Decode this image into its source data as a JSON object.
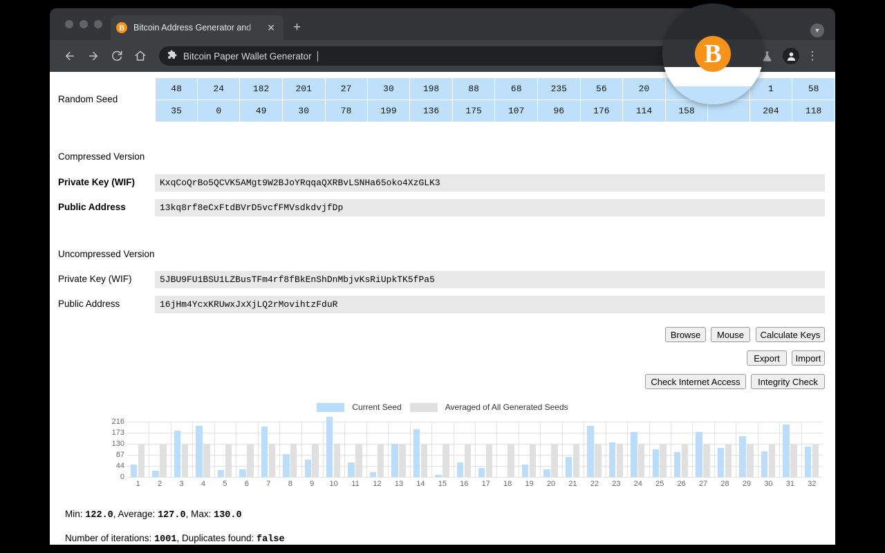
{
  "browser": {
    "tab": {
      "title": "Bitcoin Address Generator and",
      "favicon": "bitcoin-icon",
      "close": "✕"
    },
    "new_tab": "+",
    "tab_list_menu": "▼",
    "nav": {
      "back": "←",
      "forward": "→",
      "reload": "↻",
      "home": "⌂"
    },
    "omnibox": {
      "icon": "extension-puzzle-icon",
      "text": "Bitcoin Paper Wallet Generator"
    },
    "toolbar_right": {
      "flask": "flask-icon",
      "profile": "profile-icon",
      "menu": "⋮"
    }
  },
  "page": {
    "seed_label": "Random Seed",
    "seed_row1": [
      48,
      24,
      182,
      201,
      27,
      30,
      198,
      88,
      68,
      235,
      56,
      20,
      "",
      "",
      1,
      58
    ],
    "seed_row2": [
      35,
      0,
      49,
      30,
      78,
      199,
      136,
      175,
      107,
      96,
      176,
      114,
      158,
      "",
      204,
      118
    ],
    "compressed_heading": "Compressed Version",
    "compressed": {
      "privkey_label": "Private Key (WIF)",
      "privkey_value": "KxqCoQrBo5QCVK5AMgt9W2BJoYRqqaQXRBvLSNHa65oko4XzGLK3",
      "address_label": "Public Address",
      "address_value": "13kq8rf8eCxFtdBVrD5vcfFMVsdkdvjfDp"
    },
    "uncompressed_heading": "Uncompressed Version",
    "uncompressed": {
      "privkey_label": "Private Key (WIF)",
      "privkey_value": "5JBU9FU1BSU1LZBusTFm4rf8fBkEnShDnMbjvKsRiUpkTK5fPa5",
      "address_label": "Public Address",
      "address_value": "16jHm4YcxKRUwxJxXjLQ2rMovihtzFduR"
    },
    "buttons": {
      "browse": "Browse",
      "mouse": "Mouse",
      "calculate_keys": "Calculate Keys",
      "export": "Export",
      "import": "Import",
      "check_internet": "Check Internet Access",
      "integrity_check": "Integrity Check"
    },
    "stats": {
      "min_label": "Min: ",
      "min_value": "122.0",
      "avg_label": ", Average: ",
      "avg_value": "127.0",
      "max_label": ", Max: ",
      "max_value": "130.0",
      "iter_label": "Number of iterations: ",
      "iter_value": "1001",
      "dup_label": ", Duplicates found: ",
      "dup_value": "false"
    }
  },
  "colors": {
    "current_seed": "#b9ddfa",
    "averaged_seed": "#e0e0e0",
    "bitcoin_orange": "#f7931a",
    "seed_cell": "#bfe0fa"
  },
  "chart_data": {
    "type": "bar",
    "title": "",
    "xlabel": "",
    "ylabel": "",
    "ylim": [
      0,
      216
    ],
    "grid": true,
    "legend_position": "top-center",
    "yticks": [
      0,
      44,
      87,
      130,
      173,
      216
    ],
    "categories": [
      1,
      2,
      3,
      4,
      5,
      6,
      7,
      8,
      9,
      10,
      11,
      12,
      13,
      14,
      15,
      16,
      17,
      18,
      19,
      20,
      21,
      22,
      23,
      24,
      25,
      26,
      27,
      28,
      29,
      30,
      31,
      32
    ],
    "series": [
      {
        "name": "Current Seed",
        "color": "#b9ddfa",
        "values": [
          48,
          24,
          182,
          201,
          27,
          30,
          198,
          88,
          68,
          235,
          56,
          20,
          130,
          185,
          9,
          58,
          35,
          0,
          49,
          30,
          78,
          199,
          136,
          175,
          107,
          96,
          176,
          114,
          158,
          100,
          204,
          118
        ]
      },
      {
        "name": "Averaged of All Generated Seeds",
        "color": "#e0e0e0",
        "values": [
          127,
          127,
          127,
          127,
          127,
          127,
          127,
          127,
          127,
          127,
          127,
          127,
          127,
          127,
          127,
          127,
          127,
          127,
          127,
          127,
          127,
          127,
          127,
          127,
          127,
          127,
          127,
          127,
          127,
          127,
          127,
          127
        ]
      }
    ]
  }
}
